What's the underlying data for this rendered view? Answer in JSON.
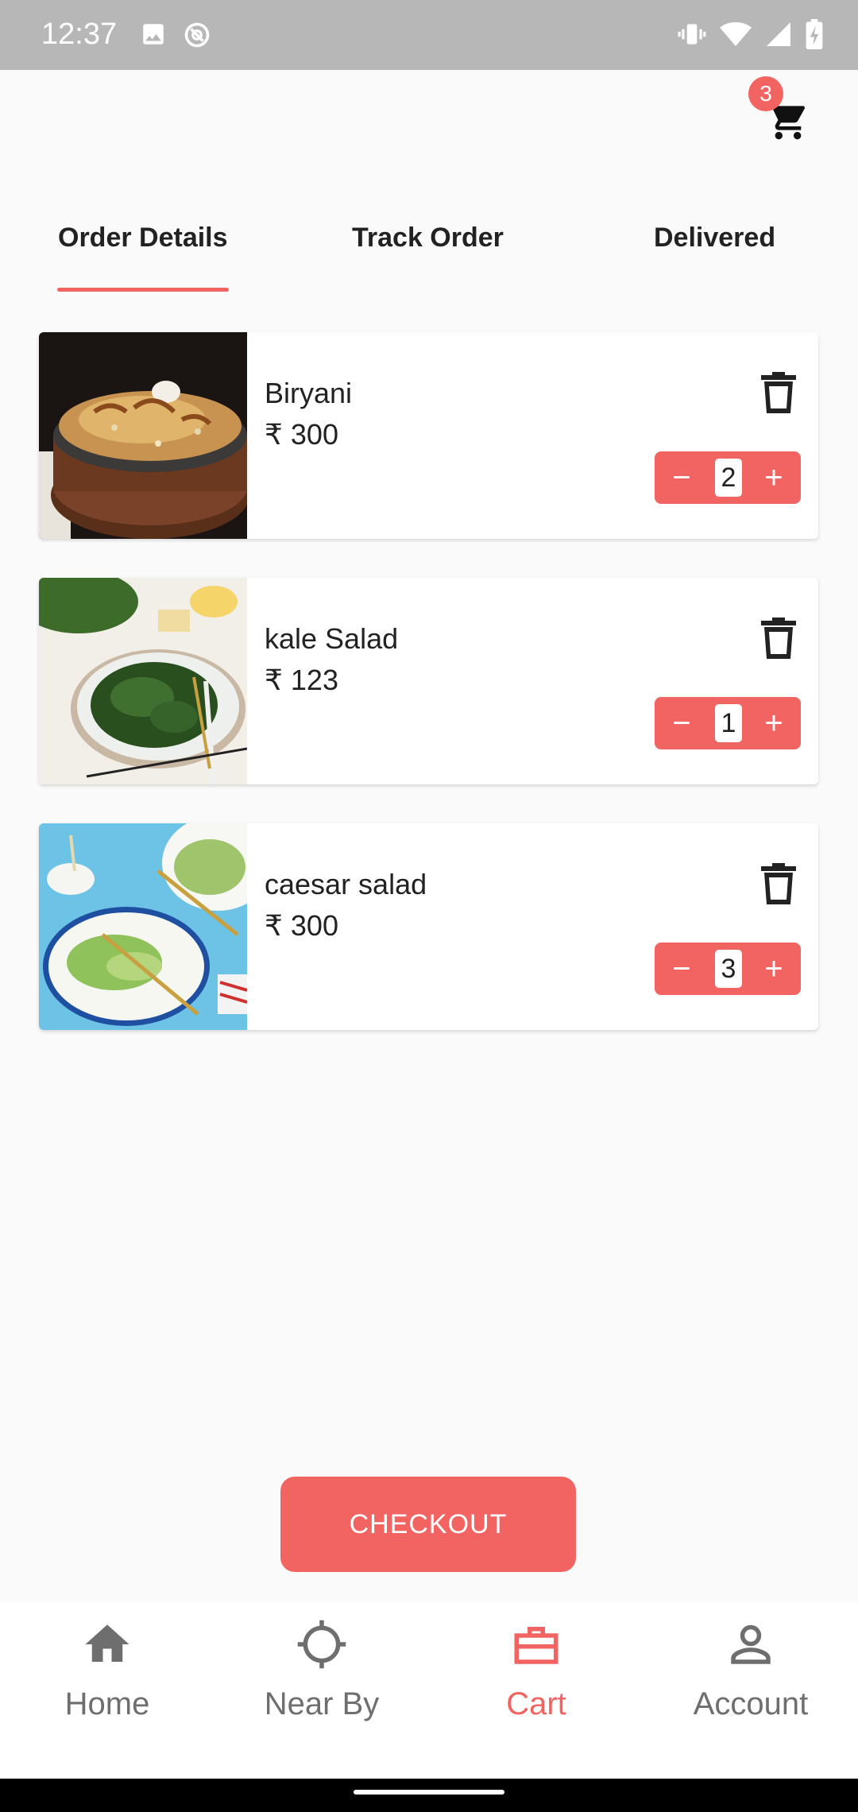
{
  "status_bar": {
    "time": "12:37"
  },
  "header": {
    "cart_badge": "3"
  },
  "tabs": [
    {
      "label": "Order Details",
      "active": true
    },
    {
      "label": "Track Order",
      "active": false
    },
    {
      "label": "Delivered",
      "active": false
    }
  ],
  "cart_items": [
    {
      "name": "Biryani",
      "price": "₹ 300",
      "quantity": "2",
      "minus": "−",
      "plus": "+"
    },
    {
      "name": "kale Salad",
      "price": "₹ 123",
      "quantity": "1",
      "minus": "−",
      "plus": "+"
    },
    {
      "name": "caesar salad",
      "price": "₹ 300",
      "quantity": "3",
      "minus": "−",
      "plus": "+"
    }
  ],
  "checkout": {
    "label": "CHECKOUT"
  },
  "bottom_nav": [
    {
      "label": "Home",
      "icon": "home-icon",
      "active": false
    },
    {
      "label": "Near By",
      "icon": "crosshair-icon",
      "active": false
    },
    {
      "label": "Cart",
      "icon": "briefcase-icon",
      "active": true
    },
    {
      "label": "Account",
      "icon": "person-icon",
      "active": false
    }
  ],
  "colors": {
    "accent": "#f26461",
    "status_bar": "#b7b7b7",
    "background": "#fafafa"
  }
}
